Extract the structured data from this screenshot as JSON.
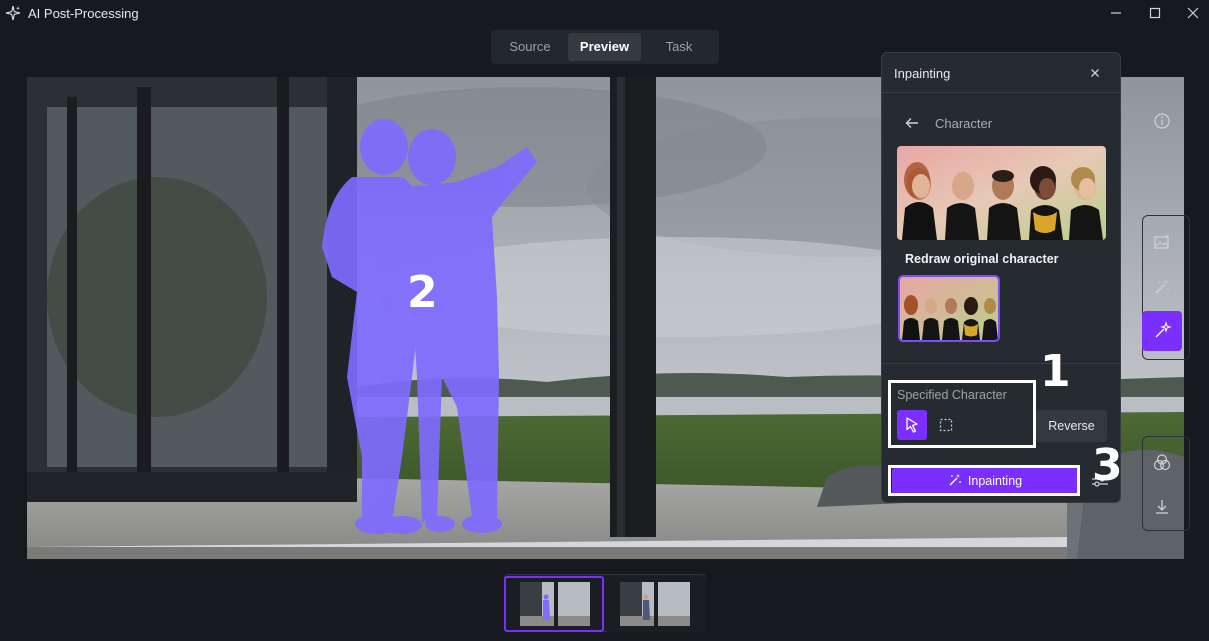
{
  "window": {
    "title": "AI Post-Processing",
    "app_icon": "sparkle-icon",
    "controls": [
      "minimize-icon",
      "maximize-icon",
      "close-icon"
    ]
  },
  "tabs": [
    {
      "label": "Source",
      "active": false
    },
    {
      "label": "Preview",
      "active": true
    },
    {
      "label": "Task",
      "active": false
    }
  ],
  "canvas": {
    "annotation": "2",
    "subject_tint": "#7f6bff"
  },
  "panel": {
    "title": "Inpainting",
    "breadcrumb": "Character",
    "section_title": "Redraw original character",
    "specified_label": "Specified Character",
    "tools": [
      {
        "icon": "pointer-select-icon",
        "active": true
      },
      {
        "icon": "marquee-select-icon",
        "active": false
      }
    ],
    "reverse_label": "Reverse",
    "inpaint_label": "Inpainting",
    "annotations": {
      "specified": "1",
      "inpaint": "3"
    }
  },
  "rail": {
    "items": [
      {
        "icon": "info-icon",
        "active": false
      },
      {
        "icon": "image-enhance-icon",
        "active": false
      },
      {
        "icon": "magic-wand-icon",
        "active": false
      },
      {
        "icon": "inpaint-wand-icon",
        "active": true
      },
      {
        "icon": "color-blend-icon",
        "active": false
      },
      {
        "icon": "download-icon",
        "active": false
      }
    ]
  },
  "filmstrip": {
    "items": [
      {
        "name": "preview-with-mask",
        "selected": true
      },
      {
        "name": "preview-plain",
        "selected": false
      }
    ]
  },
  "colors": {
    "accent": "#7b2fff",
    "panel_bg": "#262a31",
    "app_bg": "#16191e"
  }
}
